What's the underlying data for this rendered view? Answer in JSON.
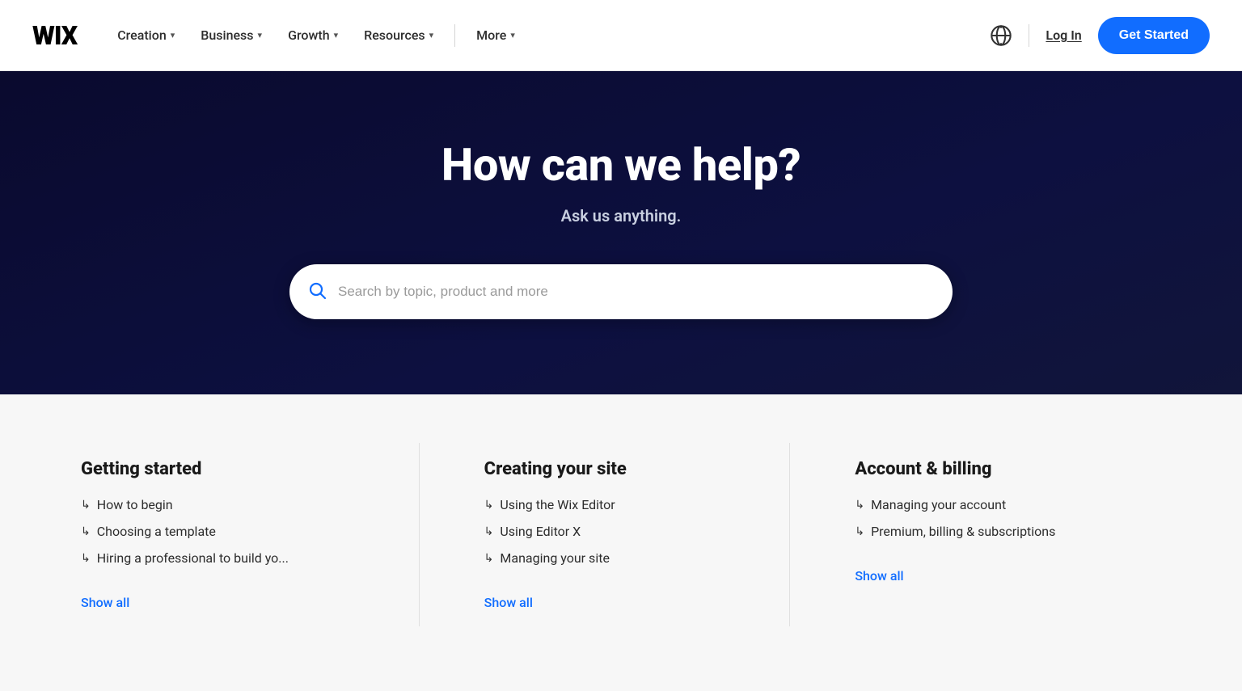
{
  "header": {
    "logo": "WIX",
    "nav": [
      {
        "label": "Creation",
        "id": "creation"
      },
      {
        "label": "Business",
        "id": "business"
      },
      {
        "label": "Growth",
        "id": "growth"
      },
      {
        "label": "Resources",
        "id": "resources"
      }
    ],
    "more_label": "More",
    "login_label": "Log In",
    "get_started_label": "Get Started"
  },
  "hero": {
    "title": "How can we help?",
    "subtitle": "Ask us anything.",
    "search_placeholder": "Search by topic, product and more"
  },
  "columns": [
    {
      "id": "getting-started",
      "title": "Getting started",
      "links": [
        "How to begin",
        "Choosing a template",
        "Hiring a professional to build yo..."
      ],
      "show_all": "Show all"
    },
    {
      "id": "creating-your-site",
      "title": "Creating your site",
      "links": [
        "Using the Wix Editor",
        "Using Editor X",
        "Managing your site"
      ],
      "show_all": "Show all"
    },
    {
      "id": "account-billing",
      "title": "Account & billing",
      "links": [
        "Managing your account",
        "Premium, billing & subscriptions"
      ],
      "show_all": "Show all"
    }
  ]
}
